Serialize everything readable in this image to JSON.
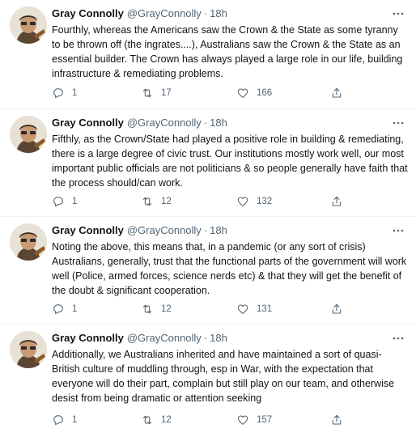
{
  "tweets": [
    {
      "name": "Gray Connolly",
      "handle": "@GrayConnolly",
      "separator": "·",
      "time": "18h",
      "text": "Fourthly, whereas the Americans saw the Crown & the State as some tyranny to be thrown off (the ingrates....), Australians saw the Crown & the State as an essential builder. The Crown has always played a large role in our life, building infrastructure & remediating problems.",
      "replies": "1",
      "retweets": "17",
      "likes": "166"
    },
    {
      "name": "Gray Connolly",
      "handle": "@GrayConnolly",
      "separator": "·",
      "time": "18h",
      "text": "Fifthly, as the Crown/State had played a positive role in building & remediating, there is a large degree of civic trust. Our institutions mostly work well, our most important public officials are not politicians & so people generally have faith that the process should/can work.",
      "replies": "1",
      "retweets": "12",
      "likes": "132"
    },
    {
      "name": "Gray Connolly",
      "handle": "@GrayConnolly",
      "separator": "·",
      "time": "18h",
      "text": "Noting the above, this means that, in a pandemic (or any sort of crisis) Australians, generally, trust that the functional parts of the government will work well (Police, armed forces, science nerds etc) & that they will get the benefit of the doubt & significant cooperation.",
      "replies": "1",
      "retweets": "12",
      "likes": "131"
    },
    {
      "name": "Gray Connolly",
      "handle": "@GrayConnolly",
      "separator": "·",
      "time": "18h",
      "text": "Additionally, we Australians inherited and have maintained a sort of quasi-British culture of muddling through, esp in War, with the expectation that everyone will do their part, complain but still play on our team, and otherwise desist from being dramatic or attention seeking",
      "replies": "1",
      "retweets": "12",
      "likes": "157"
    }
  ],
  "icons": {
    "avatar": "avatar",
    "more": "more-icon",
    "reply": "reply-icon",
    "retweet": "retweet-icon",
    "like": "like-icon",
    "share": "share-icon"
  },
  "colors": {
    "text": "#0f1419",
    "secondary": "#536471",
    "divider": "#eff3f4"
  }
}
